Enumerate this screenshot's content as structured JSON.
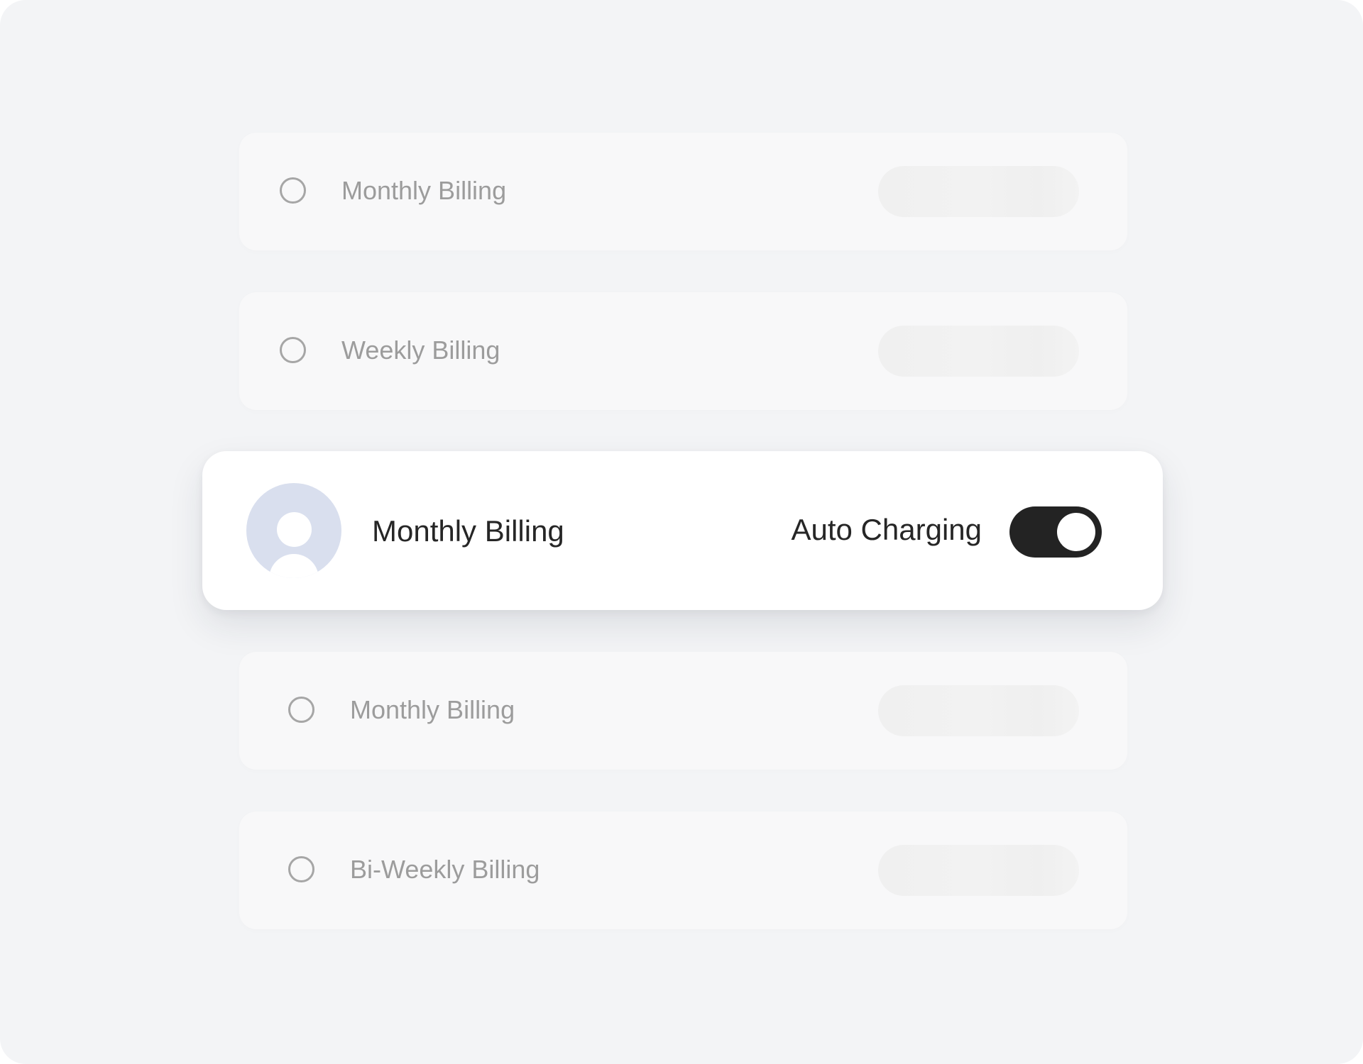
{
  "billing_options": {
    "row1_label": "Monthly Billing",
    "row2_label": "Weekly Billing",
    "row4_label": "Monthly Billing",
    "row5_label": "Bi-Weekly Billing"
  },
  "selected_option": {
    "label": "Monthly Billing",
    "avatar_icon": "user-avatar-icon",
    "auto_charging_label": "Auto Charging",
    "auto_charging_enabled": true
  },
  "colors": {
    "background": "#f3f4f6",
    "row_background": "#f8f8f9",
    "inactive_text": "#9c9c9c",
    "active_text": "#262626",
    "toggle_on": "#232323",
    "avatar_bg": "#d9dfee"
  }
}
